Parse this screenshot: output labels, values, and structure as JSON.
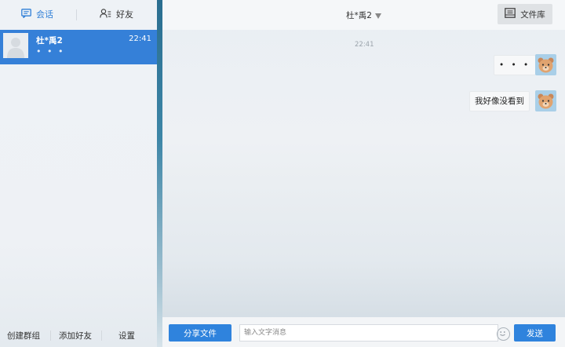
{
  "sidebar": {
    "tabs": [
      {
        "label": "会话",
        "icon": "chat-icon",
        "active": true
      },
      {
        "label": "好友",
        "icon": "contacts-icon",
        "active": false
      }
    ],
    "conversations": [
      {
        "name": "杜*禹2",
        "time": "22:41",
        "preview": "• • •"
      }
    ],
    "bottom": {
      "create_group": "创建群组",
      "add_friend": "添加好友",
      "settings": "设置"
    }
  },
  "chat": {
    "title": "杜*禹2",
    "file_library": "文件库",
    "timestamp": "22:41",
    "messages": [
      {
        "text": "• • •",
        "from": "self"
      },
      {
        "text": "我好像没看到",
        "from": "self"
      }
    ],
    "input": {
      "share_button": "分享文件",
      "placeholder": "输入文字消息",
      "send_button": "发送"
    }
  },
  "colors": {
    "accent": "#2f83dd",
    "selected_item": "#3580d8",
    "active_tab_text": "#2f7fd7"
  }
}
